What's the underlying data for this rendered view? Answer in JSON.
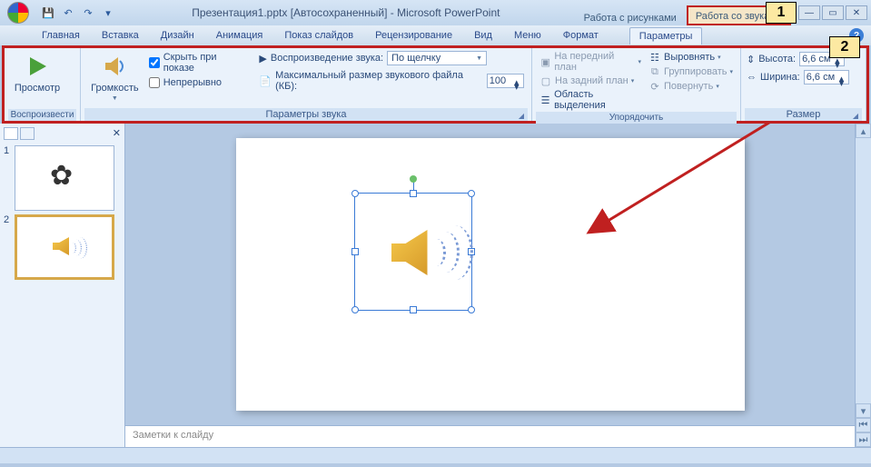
{
  "title": "Презентация1.pptx [Автосохраненный] - Microsoft PowerPoint",
  "context_tabs": {
    "pictures": "Работа с рисунками",
    "sounds": "Работа со звуками",
    "params": "Параметры"
  },
  "tabs": {
    "t0": "Главная",
    "t1": "Вставка",
    "t2": "Дизайн",
    "t3": "Анимация",
    "t4": "Показ слайдов",
    "t5": "Рецензирование",
    "t6": "Вид",
    "t7": "Меню",
    "t8": "Формат"
  },
  "ribbon": {
    "play": {
      "preview": "Просмотр",
      "title": "Воспроизвести"
    },
    "sound_options": {
      "volume": "Громкость",
      "hide_during_show": "Скрыть при показе",
      "loop": "Непрерывно",
      "sound_playback": "Воспроизведение звука:",
      "on_click": "По щелчку",
      "max_size": "Максимальный размер звукового файла (КБ):",
      "max_size_value": "100",
      "title": "Параметры звука"
    },
    "arrange": {
      "bring_front": "На передний план",
      "send_back": "На задний план",
      "selection_pane": "Область выделения",
      "align": "Выровнять",
      "group": "Группировать",
      "rotate": "Повернуть",
      "title": "Упорядочить"
    },
    "size": {
      "height": "Высота:",
      "height_value": "6,6 см",
      "width": "Ширина:",
      "width_value": "6,6 см",
      "title": "Размер"
    }
  },
  "slides": {
    "n1": "1",
    "n2": "2"
  },
  "notes": "Заметки к слайду",
  "callouts": {
    "c1": "1",
    "c2": "2"
  }
}
